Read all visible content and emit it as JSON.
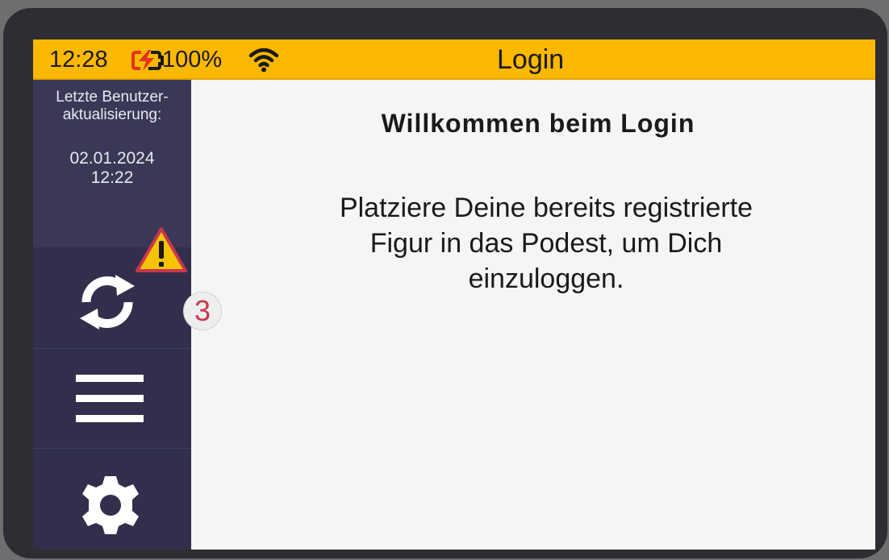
{
  "status_bar": {
    "time": "12:28",
    "battery_percent": "100%",
    "battery_icon": "battery-charging-icon",
    "wifi_icon": "wifi-icon",
    "title": "Login",
    "background_color": "#fbb800"
  },
  "sidebar": {
    "update_label": "Letzte Benutzer-\naktualisierung:",
    "update_value": "02.01.2024\n12:22",
    "background_color": "#312f4b",
    "buttons": [
      {
        "name": "refresh",
        "icon": "refresh-icon"
      },
      {
        "name": "menu",
        "icon": "hamburger-menu-icon"
      },
      {
        "name": "settings",
        "icon": "gear-icon"
      }
    ],
    "warning": {
      "icon": "warning-icon",
      "count": "3",
      "color": "#f6c300"
    }
  },
  "main": {
    "title": "Willkommen beim Login",
    "message": "Platziere Deine bereits registrierte\nFigur in das Podest, um Dich\neinzuloggen."
  }
}
